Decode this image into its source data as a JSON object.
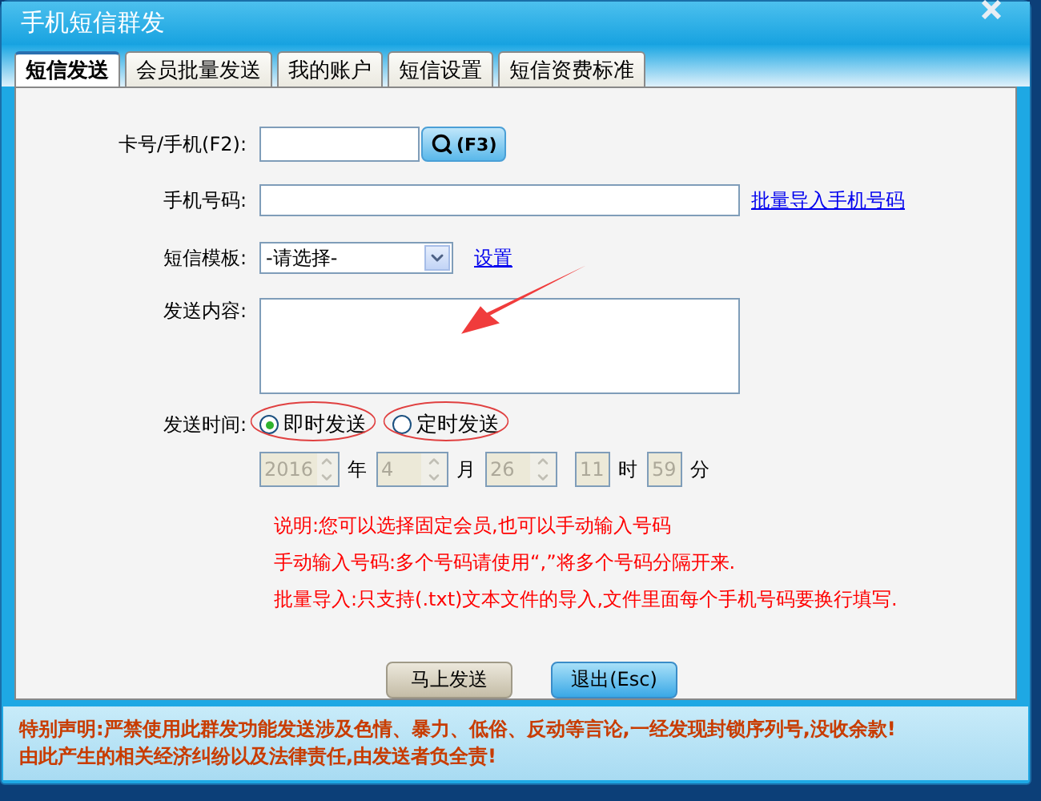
{
  "window": {
    "title": "手机短信群发"
  },
  "tabs": [
    {
      "label": "短信发送",
      "selected": true
    },
    {
      "label": "会员批量发送",
      "selected": false
    },
    {
      "label": "我的账户",
      "selected": false
    },
    {
      "label": "短信设置",
      "selected": false
    },
    {
      "label": "短信资费标准",
      "selected": false
    }
  ],
  "form": {
    "card": {
      "label": "卡号/手机(F2):",
      "button": "(F3)"
    },
    "phone": {
      "label": "手机号码:",
      "link": "批量导入手机号码"
    },
    "template": {
      "label": "短信模板:",
      "value": "-请选择-",
      "link": "设置"
    },
    "content": {
      "label": "发送内容:",
      "annotated": true
    },
    "send_time": {
      "label": "发送时间:",
      "options": [
        {
          "label": "即时发送",
          "selected": true,
          "circled": true
        },
        {
          "label": "定时发送",
          "selected": false,
          "circled": true
        }
      ]
    },
    "schedule": {
      "disabled": true,
      "fields": [
        {
          "kind": "spinner",
          "value": "2016",
          "unit": "年"
        },
        {
          "kind": "spinner",
          "value": "4",
          "unit": "月"
        },
        {
          "kind": "spinner",
          "value": "26"
        },
        {
          "kind": "plain",
          "value": "11",
          "unit": "时"
        },
        {
          "kind": "plain",
          "value": "59",
          "unit": "分"
        }
      ]
    }
  },
  "notes": [
    "说明:您可以选择固定会员,也可以手动输入号码",
    "手动输入号码:多个号码请使用“,”将多个号码分隔开来.",
    "批量导入:只支持(.txt)文本文件的导入,文件里面每个手机号码要换行填写."
  ],
  "buttons": [
    {
      "label": "马上发送",
      "kind": "default"
    },
    {
      "label": "退出(Esc)",
      "kind": "primary"
    }
  ],
  "notice": [
    "特别声明:严禁使用此群发功能发送涉及色情、暴力、低俗、反动等言论,一经发现封锁序列号,没收余款!",
    "由此产生的相关经济纠纷以及法律责任,由发送者负全责!"
  ]
}
